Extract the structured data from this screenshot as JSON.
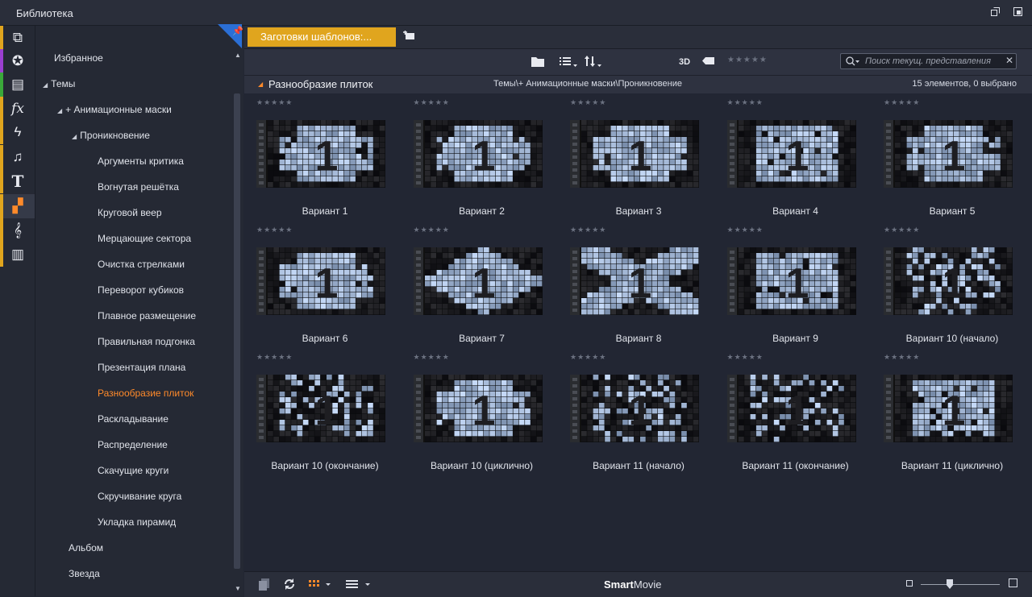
{
  "window": {
    "title": "Библиотека"
  },
  "iconbar": {
    "items": [
      {
        "name": "templates-box-icon",
        "glyph": "⧉",
        "stripe": "#e0a51e"
      },
      {
        "name": "film-reel-icon",
        "glyph": "✪",
        "stripe": "#9b3fd0"
      },
      {
        "name": "photos-icon",
        "glyph": "▤",
        "stripe": "#3aa83a"
      },
      {
        "name": "fx-icon",
        "glyph": "fx",
        "stripe": "#e0a51e"
      },
      {
        "name": "lightning-icon",
        "glyph": "ϟ",
        "stripe": "#e0a51e"
      },
      {
        "name": "music-note-icon",
        "glyph": "♫",
        "stripe": "#e0a51e"
      },
      {
        "name": "title-text-icon",
        "glyph": "T",
        "stripe": "#e0a51e"
      },
      {
        "name": "montage-icon",
        "glyph": "▞",
        "stripe": "#e0a51e"
      },
      {
        "name": "treble-clef-icon",
        "glyph": "𝄞",
        "stripe": "#e0a51e"
      },
      {
        "name": "piano-icon",
        "glyph": "▥",
        "stripe": "#e0a51e"
      }
    ]
  },
  "tree": {
    "items": [
      {
        "label": "Избранное",
        "level": 0,
        "tri": "",
        "active": false
      },
      {
        "label": "Темы",
        "level": 0,
        "tri": "◢",
        "active": false
      },
      {
        "label": "+ Анимационные маски",
        "level": 1,
        "tri": "◢",
        "active": false
      },
      {
        "label": "Проникновение",
        "level": 2,
        "tri": "◢",
        "active": false
      },
      {
        "label": "Аргументы критика",
        "level": 3,
        "tri": "",
        "active": false
      },
      {
        "label": "Вогнутая решётка",
        "level": 3,
        "tri": "",
        "active": false
      },
      {
        "label": "Круговой веер",
        "level": 3,
        "tri": "",
        "active": false
      },
      {
        "label": "Мерцающие сектора",
        "level": 3,
        "tri": "",
        "active": false
      },
      {
        "label": "Очистка стрелками",
        "level": 3,
        "tri": "",
        "active": false
      },
      {
        "label": "Переворот кубиков",
        "level": 3,
        "tri": "",
        "active": false
      },
      {
        "label": "Плавное размещение",
        "level": 3,
        "tri": "",
        "active": false
      },
      {
        "label": "Правильная подгонка",
        "level": 3,
        "tri": "",
        "active": false
      },
      {
        "label": "Презентация плана",
        "level": 3,
        "tri": "",
        "active": false
      },
      {
        "label": "Разнообразие плиток",
        "level": 3,
        "tri": "",
        "active": true
      },
      {
        "label": "Раскладывание",
        "level": 3,
        "tri": "",
        "active": false
      },
      {
        "label": "Распределение",
        "level": 3,
        "tri": "",
        "active": false
      },
      {
        "label": "Скачущие круги",
        "level": 3,
        "tri": "",
        "active": false
      },
      {
        "label": "Скручивание круга",
        "level": 3,
        "tri": "",
        "active": false
      },
      {
        "label": "Укладка пирамид",
        "level": 3,
        "tri": "",
        "active": false
      },
      {
        "label": "Альбом",
        "level": 1.5,
        "tri": "",
        "active": false
      },
      {
        "label": "Звезда",
        "level": 1.5,
        "tri": "",
        "active": false
      }
    ]
  },
  "tabs": {
    "active_label": "Заготовки шаблонов:..."
  },
  "toolbar": {
    "label_3d": "3D",
    "stars": "★★★★★",
    "search_placeholder": "Поиск текущ. представления",
    "search_clear": "✕"
  },
  "group": {
    "title": "Разнообразие плиток",
    "path": "Темы\\+ Анимационные маски\\Проникновение",
    "count": "15 элементов, 0 выбрано"
  },
  "thumb_digit": "1",
  "items": [
    {
      "label": "Вариант 1",
      "stars": "★★★★★"
    },
    {
      "label": "Вариант 2",
      "stars": "★★★★★"
    },
    {
      "label": "Вариант 3",
      "stars": "★★★★★"
    },
    {
      "label": "Вариант 4",
      "stars": "★★★★★"
    },
    {
      "label": "Вариант 5",
      "stars": "★★★★★"
    },
    {
      "label": "Вариант 6",
      "stars": "★★★★★"
    },
    {
      "label": "Вариант 7",
      "stars": "★★★★★"
    },
    {
      "label": "Вариант 8",
      "stars": "★★★★★"
    },
    {
      "label": "Вариант 9",
      "stars": "★★★★★"
    },
    {
      "label": "Вариант 10 (начало)",
      "stars": "★★★★★"
    },
    {
      "label": "Вариант 10 (окончание)",
      "stars": "★★★★★"
    },
    {
      "label": "Вариант 10 (циклично)",
      "stars": "★★★★★"
    },
    {
      "label": "Вариант 11 (начало)",
      "stars": "★★★★★"
    },
    {
      "label": "Вариант 11 (окончание)",
      "stars": "★★★★★"
    },
    {
      "label": "Вариант 11 (циклично)",
      "stars": "★★★★★"
    }
  ],
  "bottombar": {
    "brand_bold": "Smart",
    "brand_rest": "Movie"
  },
  "colors": {
    "accent": "#e0a51e",
    "active_text": "#ff8a2a",
    "pin_blue": "#2b6fd6"
  }
}
